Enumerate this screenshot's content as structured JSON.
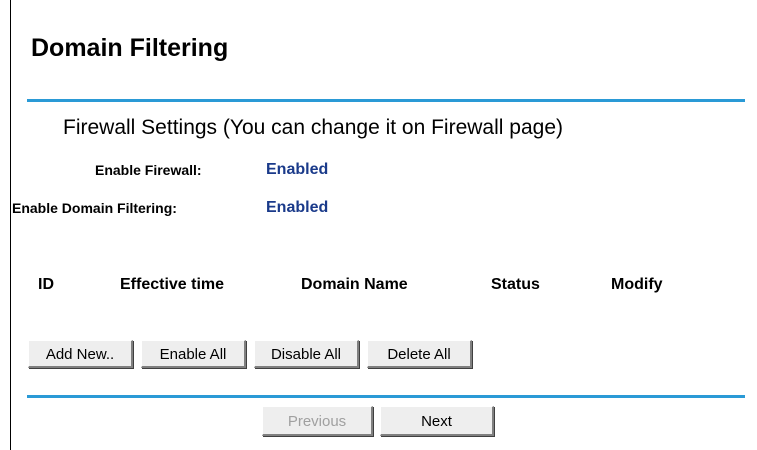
{
  "page": {
    "title": "Domain Filtering"
  },
  "firewall": {
    "heading": "Firewall Settings (You can change it on Firewall page)",
    "enable_firewall_label": "Enable Firewall:",
    "enable_firewall_value": "Enabled",
    "enable_domain_filtering_label": "Enable Domain Filtering:",
    "enable_domain_filtering_value": "Enabled"
  },
  "table": {
    "columns": [
      "ID",
      "Effective time",
      "Domain Name",
      "Status",
      "Modify"
    ],
    "rows": []
  },
  "actions": {
    "add_new": "Add New..",
    "enable_all": "Enable All",
    "disable_all": "Disable All",
    "delete_all": "Delete All"
  },
  "pagination": {
    "previous": "Previous",
    "next": "Next",
    "previous_enabled": false
  },
  "colors": {
    "rule": "#2a9ad6",
    "value_text": "#1a3a8a"
  }
}
